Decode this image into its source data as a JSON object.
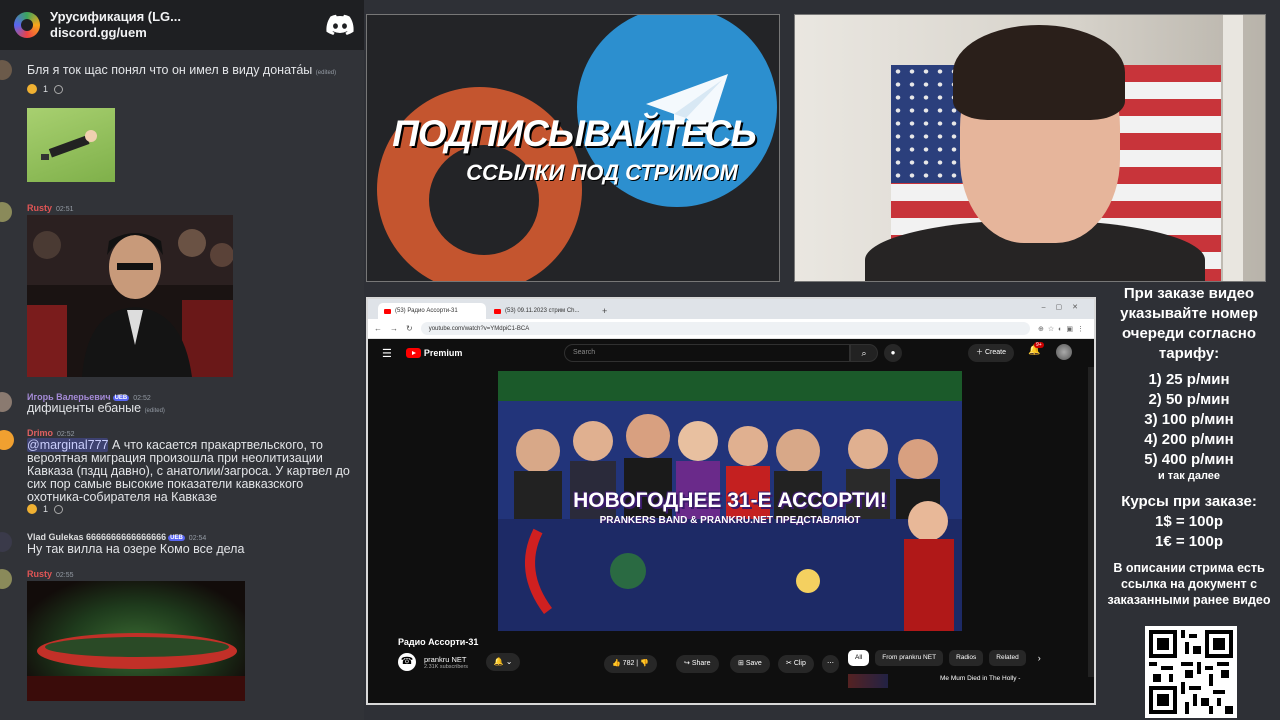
{
  "discord": {
    "server_name": "Урусификация (LG...",
    "invite": "discord.gg/uem",
    "messages": [
      {
        "text": "Бля я ток щас понял что он имел в виду доната́ы",
        "edited": "(edited)",
        "reaction_count": "1"
      },
      {
        "user": "Rusty",
        "time": "02:51"
      },
      {
        "user": "Игорь Валерьевич",
        "badge": "UEB",
        "time": "02:52",
        "text": "дифиценты ебаные",
        "edited": "(edited)"
      },
      {
        "user": "Drimo",
        "time": "02:52",
        "mention": "@marginal777",
        "text": " А что касается пракартвельского, то вероятная миграция произошла при неолитизации Кавказа (пздц давно), с анатолии/загроса. У картвел до сих пор самые высокие показатели кавказского охотника-собирателя на Кавказе",
        "reaction_count": "1"
      },
      {
        "user": "Vlad Gulekas 6666666666666666",
        "badge": "UEB",
        "time": "02:54",
        "text": "Ну так вилла на озере Комо все дела"
      },
      {
        "user": "Rusty",
        "time": "02:55"
      }
    ]
  },
  "promo": {
    "line1": "ПОДПИСЫВАЙТЕСЬ",
    "line2": "ССЫЛКИ ПОД СТРИМОМ"
  },
  "browser": {
    "tabs": [
      {
        "label": "(53) Радио Ассорти-31"
      },
      {
        "label": "(53) 09.11.2023 стрим Ch..."
      }
    ],
    "url": "youtube.com/watch?v=YMdpiC1-BCA",
    "youtube": {
      "logo": "Premium",
      "search_placeholder": "Search",
      "create": "Create",
      "notifications": "9+",
      "video_title": "Радио Ассорти-31",
      "thumb_title": "НОВОГОДНЕЕ 31-Е АССОРТИ!",
      "thumb_sub": "PRANKERS BAND & PRANKRU.NET ПРЕДСТАВЛЯЮТ",
      "channel": "prankru NET",
      "subscribers": "2.31K subscribers",
      "likes": "782",
      "share": "Share",
      "save": "Save",
      "clip": "Clip",
      "chips": [
        "All",
        "From prankru NET",
        "Radios",
        "Related"
      ],
      "next_title": "Me Mum Died in The Holly -"
    }
  },
  "pricing": {
    "intro": "При заказе видео указывайте номер очереди согласно тарифу:",
    "tiers": [
      "1) 25 р/мин",
      "2) 50 р/мин",
      "3) 100 р/мин",
      "4) 200 р/мин",
      "5) 400 р/мин"
    ],
    "more": "и так далее",
    "rates_title": "Курсы при заказе:",
    "rates": [
      "1$ = 100р",
      "1€ = 100р"
    ],
    "note": "В описании стрима есть ссылка на документ с заказанными ранее видео"
  }
}
